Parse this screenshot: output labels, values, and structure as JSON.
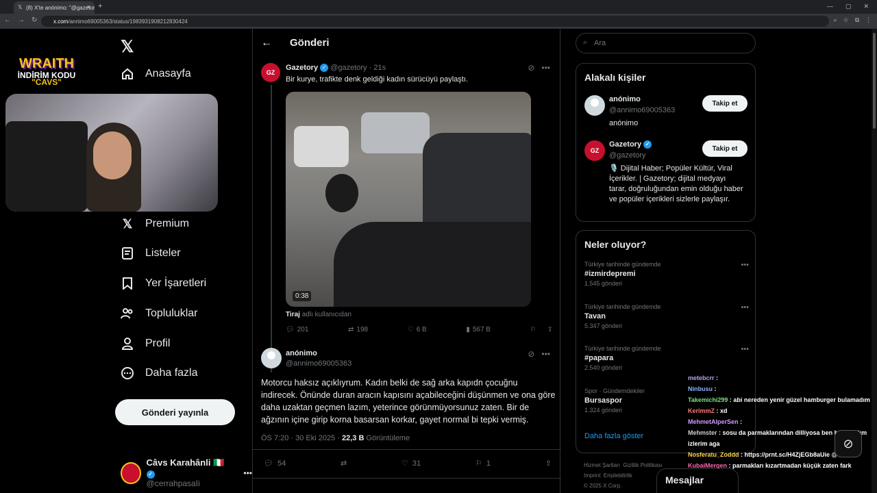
{
  "browser": {
    "tab_title": "(8) X'te anónimo: \"@gazetory B",
    "url_host": "x.com",
    "url_path": "/annimo69005363/status/1983931908212830424"
  },
  "overlay": {
    "brand": "WRAITH",
    "code_label": "İNDİRİM KODU",
    "code": "\"CAVS\""
  },
  "sidebar": {
    "items": [
      {
        "label": "Anasayfa",
        "icon": "home-icon"
      },
      {
        "label": "Premium",
        "icon": "x-icon"
      },
      {
        "label": "Listeler",
        "icon": "list-icon"
      },
      {
        "label": "Yer İşaretleri",
        "icon": "bookmark-icon"
      },
      {
        "label": "Topluluklar",
        "icon": "communities-icon"
      },
      {
        "label": "Profil",
        "icon": "profile-icon"
      },
      {
        "label": "Daha fazla",
        "icon": "more-icon"
      }
    ],
    "post_button": "Gönderi yayınla",
    "account": {
      "name": "Câvs Karahânli 🇮🇹",
      "handle": "@cerrahpasaIi"
    }
  },
  "main": {
    "title": "Gönderi",
    "quoted": {
      "name": "Gazetory",
      "handle": "@gazetory · 21s",
      "text": "Bir kurye, trafikte denk geldiği kadın sürücüyü paylaştı.",
      "video_time": "0:38",
      "tag_name": "Tiraj",
      "tag_rest": "adlı kullanıcıdan",
      "stats": {
        "replies": "201",
        "reposts": "198",
        "likes": "6 B",
        "views": "567 B"
      }
    },
    "post": {
      "name": "anónimo",
      "handle": "@annimo69005363",
      "text": "Motorcu haksız açıklıyrum. Kadın belki de sağ arka kapıdn çocuğnu indirecek. Önünde duran aracın kapısını açabileceğini düşünmen ve ona göre daha uzaktan geçmen lazım, yeterince görünmüyorsunuz zaten. Bir de ağzının içine girip korna basarsan korkar, gayet normal bi tepki vermiş.",
      "time": "ÖS 7:20 · 30 Eki 2025 ·",
      "views": "22,3 B",
      "views_label": "Görüntüleme",
      "stats": {
        "replies": "54",
        "likes": "31",
        "bookmarks": "1"
      }
    }
  },
  "right": {
    "search_placeholder": "Ara",
    "related_title": "Alakalı kişiler",
    "people": [
      {
        "name": "anónimo",
        "handle": "@annimo69005363",
        "bio": "anónimo",
        "follow": "Takip et"
      },
      {
        "name": "Gazetory",
        "handle": "@gazetory",
        "bio": "🎙️ Dijital Haber; Popüler Kültür, Viral İçerikler. | Gazetory; dijital medyayı tarar, doğruluğundan emin olduğu haber ve popüler içerikleri sizlerle paylaşır.",
        "follow": "Takip et"
      }
    ],
    "trends_title": "Neler oluyor?",
    "trends": [
      {
        "context": "Türkiye tarihinde gündemde",
        "topic": "#izmirdepremi",
        "count": "1.545 gönderi"
      },
      {
        "context": "Türkiye tarihinde gündemde",
        "topic": "Tavan",
        "count": "5.347 gönderi"
      },
      {
        "context": "Türkiye tarihinde gündemde",
        "topic": "#papara",
        "count": "2.540 gönderi"
      },
      {
        "context": "Spor · Gündemdekiler",
        "topic": "Bursaspor",
        "count": "1.324 gönderi"
      }
    ],
    "show_more": "Daha fazla göster",
    "footer": [
      "Hizmet Şartları",
      "Gizlilik Politikası",
      "Imprint",
      "Erişilebilirlik",
      "© 2025 X Corp."
    ]
  },
  "chat": [
    {
      "user": "metebcrr",
      "msg": ""
    },
    {
      "user": "Ninbusu",
      "msg": ""
    },
    {
      "user": "Takemichi299",
      "msg": "abi nereden yenir güzel hamburger bulamadım"
    },
    {
      "user": "KerimmZ",
      "msg": "xd"
    },
    {
      "user": "MehmetAlperSen",
      "msg": ""
    },
    {
      "user": "Mehmster",
      "msg": "sosu da parmaklarından dilliyosa ben bulamadım izlerim aga"
    },
    {
      "user": "Nosferatu_Zoddd",
      "msg": "https://prnt.sc/H4ZjEGb8aUie @Cavs"
    },
    {
      "user": "KubaiMergen",
      "msg": "parmakları kızartmadan küçük zaten fark etmiyordur"
    }
  ],
  "messages_label": "Mesajlar"
}
